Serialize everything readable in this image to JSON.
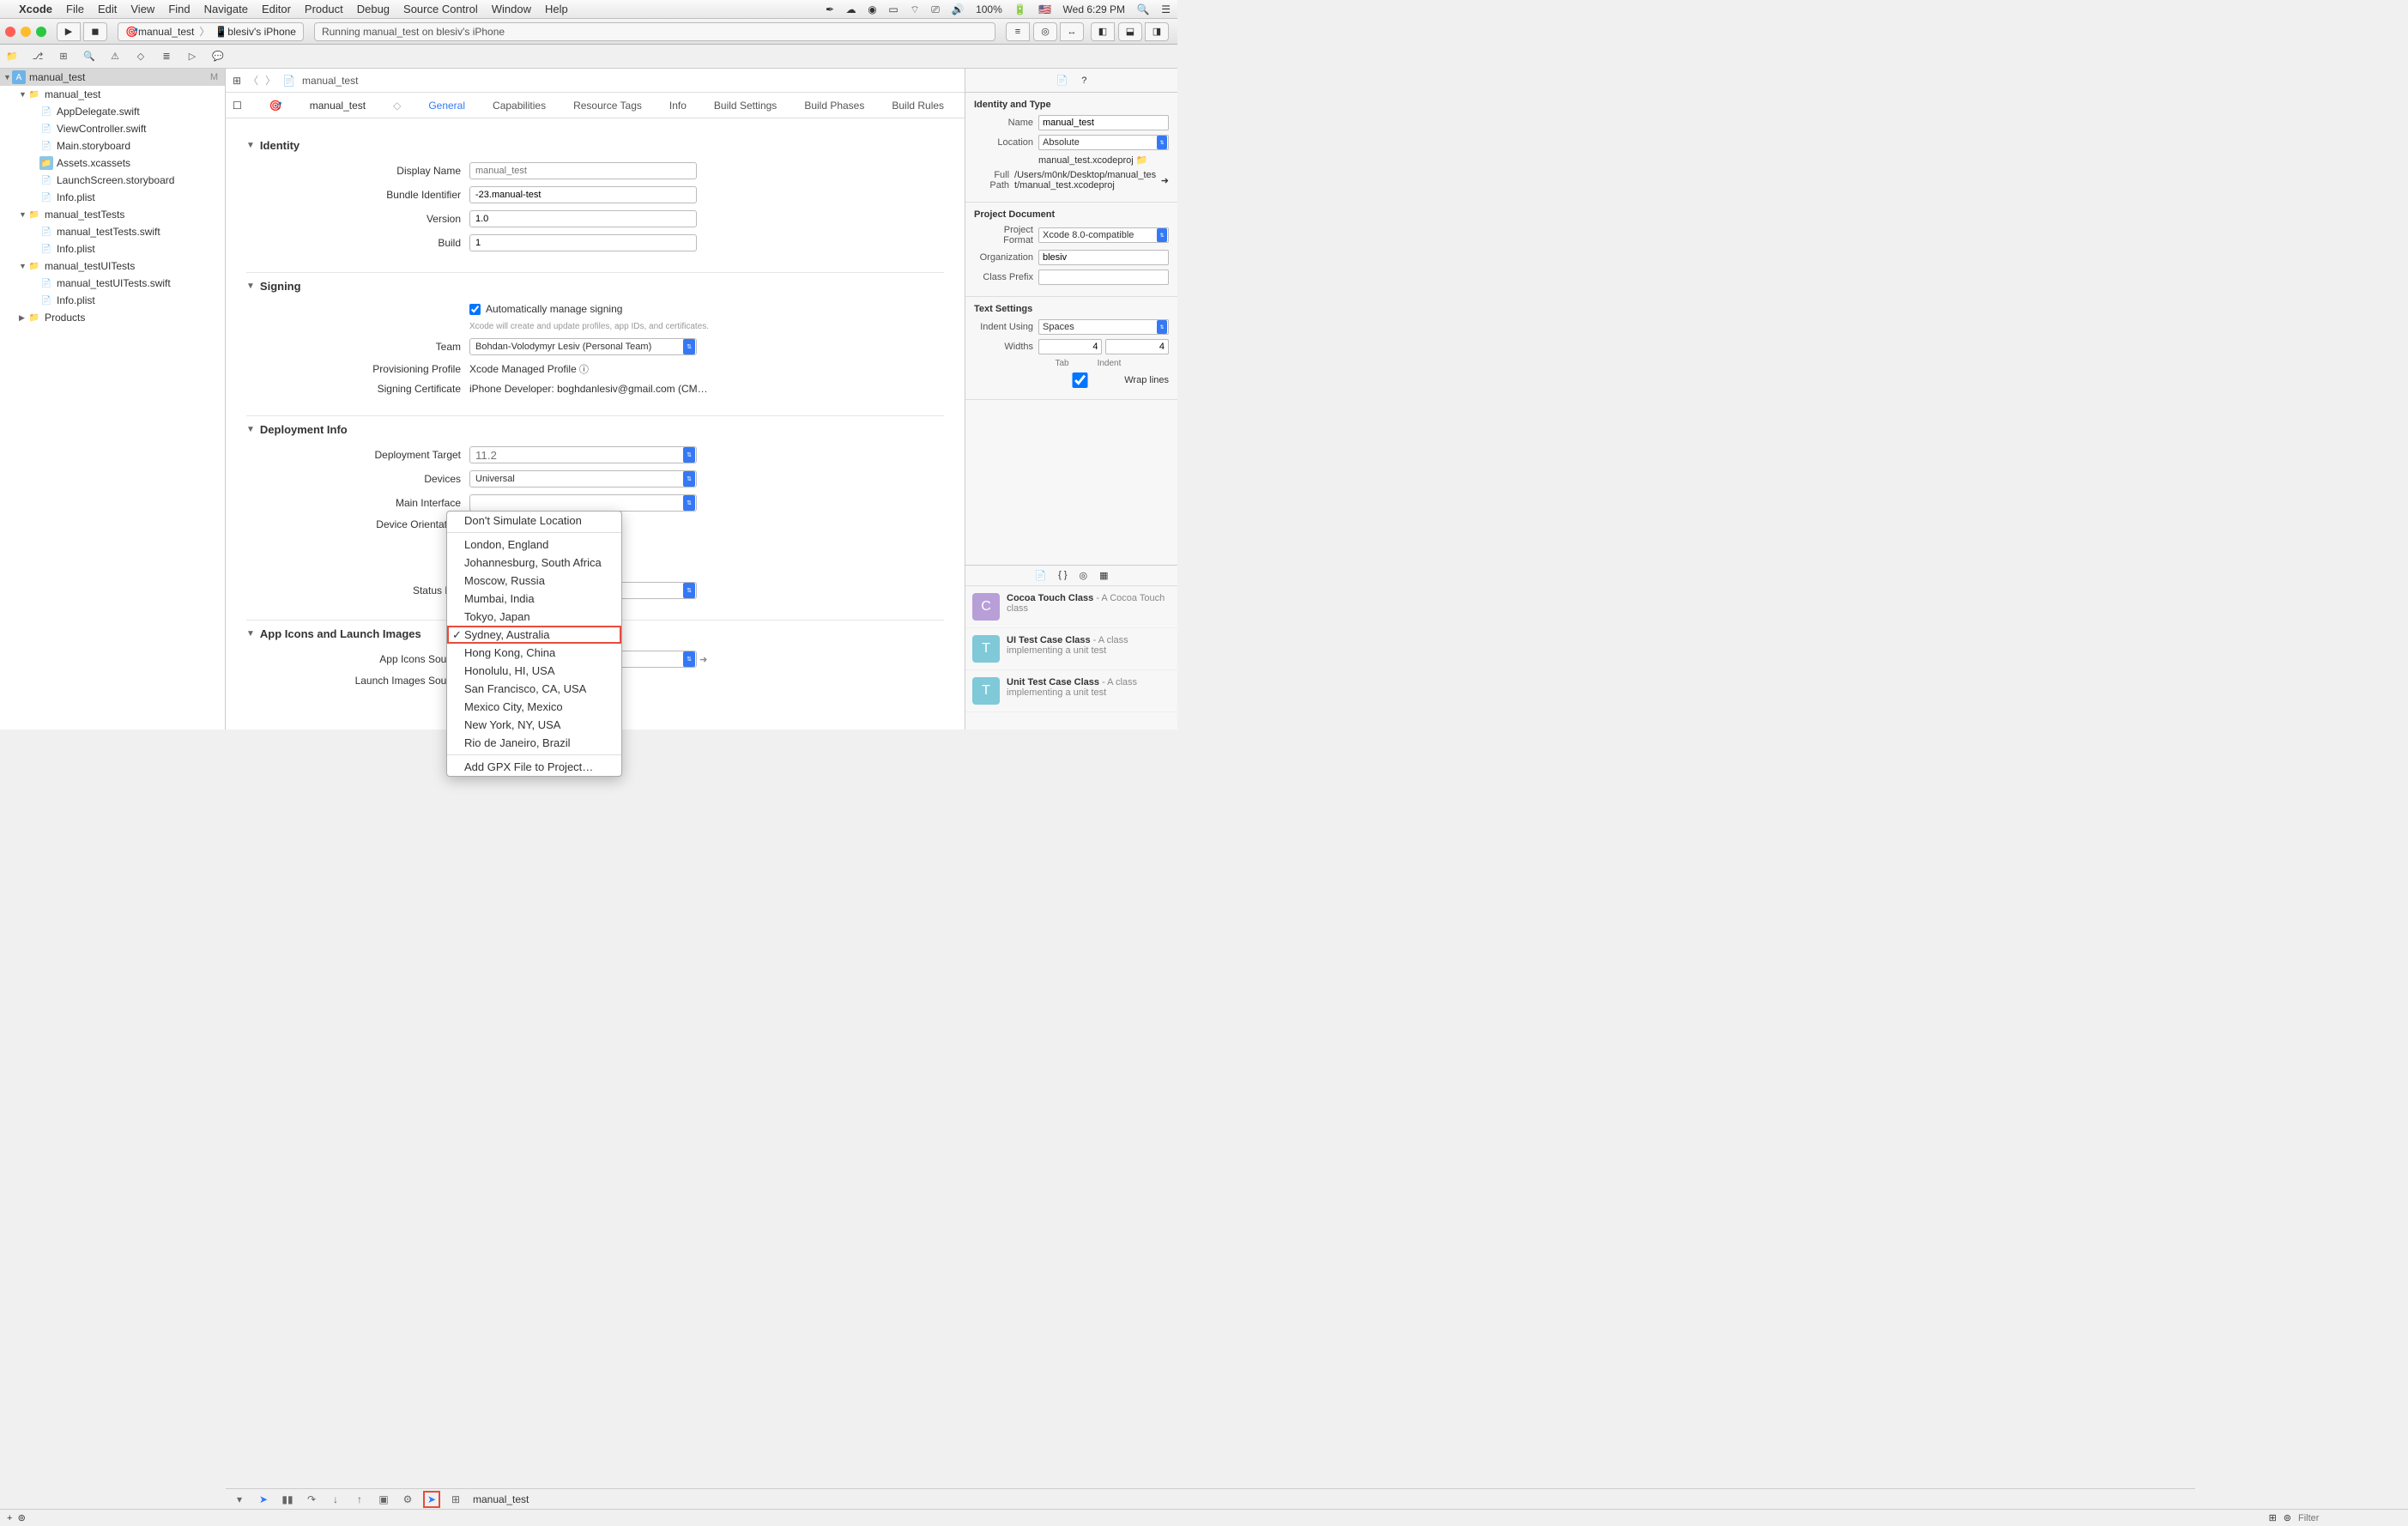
{
  "menubar": {
    "app": "Xcode",
    "items": [
      "File",
      "Edit",
      "View",
      "Find",
      "Navigate",
      "Editor",
      "Product",
      "Debug",
      "Source Control",
      "Window",
      "Help"
    ],
    "battery": "100%",
    "clock": "Wed 6:29 PM"
  },
  "toolbar": {
    "scheme_target": "manual_test",
    "scheme_device": "blesiv's iPhone",
    "activity": "Running manual_test on  blesiv's iPhone"
  },
  "navigator": {
    "project": "manual_test",
    "badge": "M",
    "tree": [
      {
        "l": 1,
        "t": "folder",
        "n": "manual_test",
        "open": true
      },
      {
        "l": 2,
        "t": "swift",
        "n": "AppDelegate.swift"
      },
      {
        "l": 2,
        "t": "swift",
        "n": "ViewController.swift"
      },
      {
        "l": 2,
        "t": "sb",
        "n": "Main.storyboard"
      },
      {
        "l": 2,
        "t": "assets",
        "n": "Assets.xcassets"
      },
      {
        "l": 2,
        "t": "sb",
        "n": "LaunchScreen.storyboard"
      },
      {
        "l": 2,
        "t": "plist",
        "n": "Info.plist"
      },
      {
        "l": 1,
        "t": "folder",
        "n": "manual_testTests",
        "open": true
      },
      {
        "l": 2,
        "t": "swift",
        "n": "manual_testTests.swift"
      },
      {
        "l": 2,
        "t": "plist",
        "n": "Info.plist"
      },
      {
        "l": 1,
        "t": "folder",
        "n": "manual_testUITests",
        "open": true
      },
      {
        "l": 2,
        "t": "swift",
        "n": "manual_testUITests.swift"
      },
      {
        "l": 2,
        "t": "plist",
        "n": "Info.plist"
      },
      {
        "l": 1,
        "t": "folder",
        "n": "Products",
        "open": false
      }
    ]
  },
  "jumpbar": {
    "proj": "manual_test",
    "file": "manual_test"
  },
  "editor_tabs": [
    "General",
    "Capabilities",
    "Resource Tags",
    "Info",
    "Build Settings",
    "Build Phases",
    "Build Rules"
  ],
  "editor_tabs_active": 0,
  "identity": {
    "title": "Identity",
    "display_name_lbl": "Display Name",
    "display_name_ph": "manual_test",
    "bundle_id_lbl": "Bundle Identifier",
    "bundle_id": "-23.manual-test",
    "version_lbl": "Version",
    "version": "1.0",
    "build_lbl": "Build",
    "build": "1"
  },
  "signing": {
    "title": "Signing",
    "auto_lbl": "Automatically manage signing",
    "auto_hint": "Xcode will create and update profiles, app IDs, and certificates.",
    "team_lbl": "Team",
    "team": "Bohdan-Volodymyr Lesiv (Personal Team)",
    "prof_lbl": "Provisioning Profile",
    "prof": "Xcode Managed Profile",
    "cert_lbl": "Signing Certificate",
    "cert": "iPhone Developer: boghdanlesiv@gmail.com (CM…"
  },
  "deployment": {
    "title": "Deployment Info",
    "target_lbl": "Deployment Target",
    "target_ph": "11.2",
    "devices_lbl": "Devices",
    "devices": "Universal",
    "main_if_lbl": "Main Interface",
    "orient_lbl": "Device Orientation",
    "status_lbl": "Status Bar"
  },
  "appicons": {
    "title": "App Icons and Launch Images",
    "icons_lbl": "App Icons Source",
    "launch_lbl": "Launch Images Source"
  },
  "popup": {
    "top": "Don't Simulate Location",
    "items": [
      "London, England",
      "Johannesburg, South Africa",
      "Moscow, Russia",
      "Mumbai, India",
      "Tokyo, Japan",
      "Sydney, Australia",
      "Hong Kong, China",
      "Honolulu, HI, USA",
      "San Francisco, CA, USA",
      "Mexico City, Mexico",
      "New York, NY, USA",
      "Rio de Janeiro, Brazil"
    ],
    "selected": "Sydney, Australia",
    "bottom": "Add GPX File to Project…"
  },
  "debugbar": {
    "target": "manual_test"
  },
  "inspector": {
    "identity_title": "Identity and Type",
    "name_lbl": "Name",
    "name": "manual_test",
    "location_lbl": "Location",
    "location": "Absolute",
    "location_file": "manual_test.xcodeproj",
    "fullpath_lbl": "Full Path",
    "fullpath": "/Users/m0nk/Desktop/manual_test/manual_test.xcodeproj",
    "doc_title": "Project Document",
    "format_lbl": "Project Format",
    "format": "Xcode 8.0-compatible",
    "org_lbl": "Organization",
    "org": "blesiv",
    "prefix_lbl": "Class Prefix",
    "prefix": "",
    "text_title": "Text Settings",
    "indent_lbl": "Indent Using",
    "indent": "Spaces",
    "widths_lbl": "Widths",
    "tab": "4",
    "indentw": "4",
    "tab_lbl": "Tab",
    "indentw_lbl": "Indent",
    "wrap_lbl": "Wrap lines"
  },
  "library": [
    {
      "name": "Cocoa Touch Class",
      "desc": " - A Cocoa Touch class",
      "icon": "C",
      "color": "#b89fd8"
    },
    {
      "name": "UI Test Case Class",
      "desc": " - A class implementing a unit test",
      "icon": "T",
      "color": "#7fc9d8"
    },
    {
      "name": "Unit Test Case Class",
      "desc": " - A class implementing a unit test",
      "icon": "T",
      "color": "#7fc9d8"
    }
  ],
  "filter_ph": "Filter"
}
